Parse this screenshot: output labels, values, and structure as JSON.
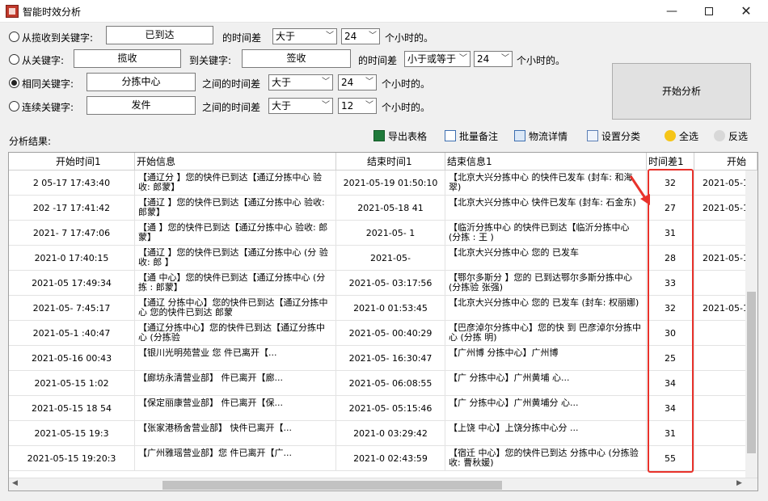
{
  "window": {
    "title": "智能时效分析",
    "minimize": "—",
    "close": "✕"
  },
  "form": {
    "row1": {
      "radio_label": "从揽收到关键字:",
      "keyword": "已到达",
      "diff_label": "的时间差",
      "compare": "大于",
      "hours": "24",
      "unit": "个小时的。"
    },
    "row2": {
      "radio_label": "从关键字:",
      "keyword_from": "揽收",
      "to_label": "到关键字:",
      "keyword_to": "签收",
      "diff_label": "的时间差",
      "compare": "小于或等于",
      "hours": "24",
      "unit": "个小时的。"
    },
    "row3": {
      "radio_label": "相同关键字:",
      "keyword": "分拣中心",
      "diff_label": "之间的时间差",
      "compare": "大于",
      "hours": "24",
      "unit": "个小时的。"
    },
    "row4": {
      "radio_label": "连续关键字:",
      "keyword": "发件",
      "diff_label": "之间的时间差",
      "compare": "大于",
      "hours": "12",
      "unit": "个小时的。"
    },
    "start_button": "开始分析"
  },
  "results": {
    "label": "分析结果:",
    "toolbar": {
      "export": "导出表格",
      "batch_note": "批量备注",
      "logistics": "物流详情",
      "set_category": "设置分类",
      "select_all": "全选",
      "invert": "反选"
    }
  },
  "grid": {
    "headers": [
      "开始时间1",
      "开始信息",
      "结束时间1",
      "结束信息1",
      "时间差1",
      "开始"
    ],
    "rows": [
      {
        "start_time": "2   05-17 17:43:40",
        "start_info": "【通辽分    】您的快件已到达【通辽分拣中心    验收: 郎蒙】",
        "end_time": "2021-05-19 01:50:10",
        "end_info": "【北京大兴分拣中心    的快件已发车 (封车: 和海翠)",
        "diff": "32",
        "next": "2021-05-1"
      },
      {
        "start_time": "202   -17 17:41:42",
        "start_info": "【通辽    】您的快件已到达【通辽分拣中心    验收: 郎蒙】",
        "end_time": "2021-05-18       41",
        "end_info": "【北京大兴分拣中心    快件已发车 (封车: 石金东)",
        "diff": "27",
        "next": "2021-05-1"
      },
      {
        "start_time": "2021-    7 17:47:06",
        "start_info": "【通    】您的快件已到达【通辽分拣中心    验收: 郎蒙】",
        "end_time": "2021-05-       1",
        "end_info": "【临沂分拣中心    的快件已到达【临沂分拣中心 (分拣    : 王    )",
        "diff": "31",
        "next": ""
      },
      {
        "start_time": "2021-0    17:40:15",
        "start_info": "【通辽    】您的快件已到达【通辽分拣中心 (分    验收: 郎    】",
        "end_time": "2021-05-       ",
        "end_info": "【北京大兴分拣中心    您的    已发车",
        "diff": "28",
        "next": "2021-05-1"
      },
      {
        "start_time": "2021-05    17:49:34",
        "start_info": "【通    中心】您的快件已到达【通辽分拣中心 (分拣    : 郎蒙】",
        "end_time": "2021-05-    03:17:56",
        "end_info": "【鄂尔多斯分    】您的    已到达鄂尔多斯分拣中心 (分拣验    张强)",
        "diff": "33",
        "next": ""
      },
      {
        "start_time": "2021-05-    7:45:17",
        "start_info": "【通辽    分拣中心】您的快件已到达【通辽分拣中心    您的快件已到达 郎蒙",
        "end_time": "2021-0    01:53:45",
        "end_info": "【北京大兴分拣中心    您的    已发车 (封车: 权丽娜)",
        "diff": "32",
        "next": "2021-05-1"
      },
      {
        "start_time": "2021-05-1    :40:47",
        "start_info": "【通辽分拣中心】您的快件已到达【通辽分拣中心 (分拣验    ",
        "end_time": "2021-05-    00:40:29",
        "end_info": "【巴彦淖尔分拣中心】您的快    到    巴彦淖尔分拣中心 (分拣    明)",
        "diff": "30",
        "next": ""
      },
      {
        "start_time": "2021-05-16    00:43",
        "start_info": "【银川光明苑营业    您    件已离开【...",
        "end_time": "2021-05-    16:30:47",
        "end_info": "【广州博    分拣中心】广州博    ",
        "diff": "25",
        "next": ""
      },
      {
        "start_time": "2021-05-15    1:02",
        "start_info": "【廊坊永清营业部】    件已离开【廊...",
        "end_time": "2021-05-    06:08:55",
        "end_info": "【广    分拣中心】广州黄埔    心...",
        "diff": "34",
        "next": ""
      },
      {
        "start_time": "2021-05-15 18    54",
        "start_info": "【保定丽康营业部】    件已离开【保...",
        "end_time": "2021-05-    05:15:46",
        "end_info": "【广    分拣中心】广州黄埔分    心...",
        "diff": "34",
        "next": ""
      },
      {
        "start_time": "2021-05-15 19:3",
        "start_info": "【张家港杨舍营业部】    快件已离开【...",
        "end_time": "2021-0    03:29:42",
        "end_info": "【上饶    中心】上饶分拣中心分    ...",
        "diff": "31",
        "next": ""
      },
      {
        "start_time": "2021-05-15 19:20:3",
        "start_info": "【广州雅瑶营业部】您    件已离开【广...",
        "end_time": "2021-0    02:43:59",
        "end_info": "【宿迁    中心】您的快件已到达    分拣中心 (分拣验收: 曹秋媛)",
        "diff": "55",
        "next": ""
      }
    ]
  },
  "colors": {
    "annotation_red": "#e8322b",
    "form_bg": "#f0f0f0"
  }
}
